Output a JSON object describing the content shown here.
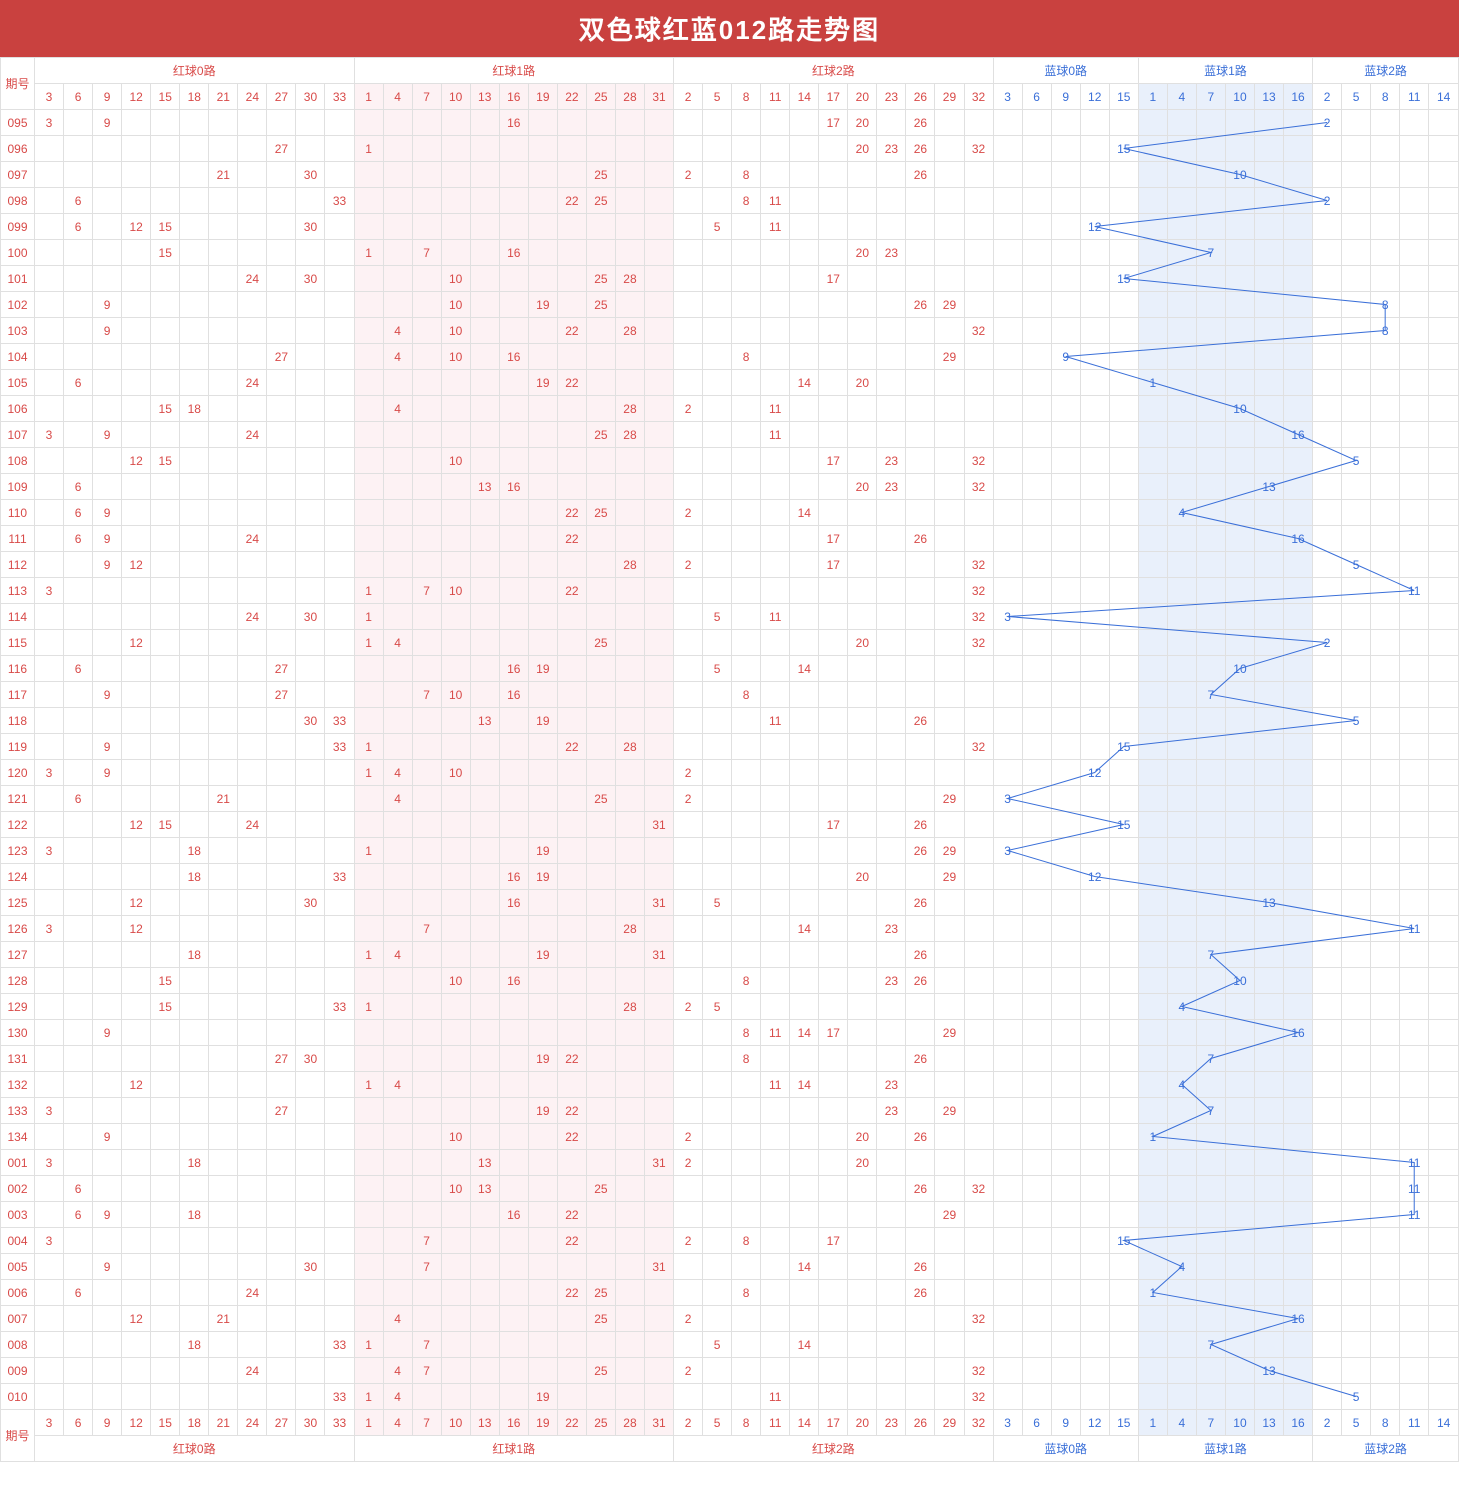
{
  "title": "双色球红蓝012路走势图",
  "period_header": "期号",
  "groups": [
    {
      "name": "红球0路",
      "nums": [
        3,
        6,
        9,
        12,
        15,
        18,
        21,
        24,
        27,
        30,
        33
      ],
      "type": "red",
      "shade": false
    },
    {
      "name": "红球1路",
      "nums": [
        1,
        4,
        7,
        10,
        13,
        16,
        19,
        22,
        25,
        28,
        31
      ],
      "type": "red",
      "shade": true
    },
    {
      "name": "红球2路",
      "nums": [
        2,
        5,
        8,
        11,
        14,
        17,
        20,
        23,
        26,
        29,
        32
      ],
      "type": "red",
      "shade": false
    },
    {
      "name": "蓝球0路",
      "nums": [
        3,
        6,
        9,
        12,
        15
      ],
      "type": "blue",
      "shade": false
    },
    {
      "name": "蓝球1路",
      "nums": [
        1,
        4,
        7,
        10,
        13,
        16
      ],
      "type": "blue",
      "shade": true
    },
    {
      "name": "蓝球2路",
      "nums": [
        2,
        5,
        8,
        11,
        14
      ],
      "type": "blue",
      "shade": false
    }
  ],
  "chart_data": {
    "type": "table",
    "title": "双色球红蓝012路走势图",
    "rows": [
      {
        "period": "095",
        "reds": [
          3,
          9,
          16,
          17,
          20,
          26
        ],
        "blue": 2
      },
      {
        "period": "096",
        "reds": [
          27,
          1,
          20,
          23,
          26,
          32
        ],
        "blue": 15
      },
      {
        "period": "097",
        "reds": [
          21,
          30,
          25,
          2,
          8,
          26
        ],
        "blue": 10
      },
      {
        "period": "098",
        "reds": [
          6,
          33,
          22,
          25,
          8,
          11
        ],
        "blue": 2
      },
      {
        "period": "099",
        "reds": [
          6,
          12,
          15,
          30,
          5,
          11
        ],
        "blue": 12
      },
      {
        "period": "100",
        "reds": [
          15,
          1,
          7,
          16,
          20,
          23
        ],
        "blue": 7
      },
      {
        "period": "101",
        "reds": [
          24,
          30,
          10,
          25,
          28,
          17
        ],
        "blue": 15
      },
      {
        "period": "102",
        "reds": [
          9,
          10,
          19,
          25,
          26,
          29
        ],
        "blue": 8
      },
      {
        "period": "103",
        "reds": [
          9,
          4,
          10,
          22,
          28,
          32
        ],
        "blue": 8
      },
      {
        "period": "104",
        "reds": [
          27,
          4,
          10,
          16,
          8,
          29
        ],
        "blue": 9
      },
      {
        "period": "105",
        "reds": [
          6,
          24,
          19,
          22,
          14,
          20
        ],
        "blue": 1
      },
      {
        "period": "106",
        "reds": [
          15,
          18,
          4,
          28,
          2,
          11
        ],
        "blue": 10
      },
      {
        "period": "107",
        "reds": [
          3,
          9,
          24,
          25,
          28,
          11
        ],
        "blue": 16
      },
      {
        "period": "108",
        "reds": [
          12,
          15,
          10,
          17,
          23,
          32
        ],
        "blue": 5
      },
      {
        "period": "109",
        "reds": [
          6,
          13,
          16,
          20,
          23,
          32
        ],
        "blue": 13
      },
      {
        "period": "110",
        "reds": [
          6,
          9,
          22,
          25,
          2,
          14
        ],
        "blue": 4
      },
      {
        "period": "111",
        "reds": [
          6,
          9,
          24,
          22,
          17,
          26
        ],
        "blue": 16
      },
      {
        "period": "112",
        "reds": [
          9,
          12,
          28,
          2,
          17,
          32
        ],
        "blue": 5
      },
      {
        "period": "113",
        "reds": [
          3,
          1,
          7,
          10,
          22,
          32
        ],
        "blue": 11
      },
      {
        "period": "114",
        "reds": [
          24,
          30,
          1,
          5,
          11,
          32
        ],
        "blue": 3
      },
      {
        "period": "115",
        "reds": [
          12,
          1,
          4,
          25,
          20,
          32
        ],
        "blue": 2
      },
      {
        "period": "116",
        "reds": [
          6,
          27,
          16,
          19,
          5,
          14
        ],
        "blue": 10
      },
      {
        "period": "117",
        "reds": [
          9,
          27,
          7,
          10,
          16,
          8
        ],
        "blue": 7
      },
      {
        "period": "118",
        "reds": [
          30,
          33,
          13,
          19,
          11,
          26
        ],
        "blue": 5
      },
      {
        "period": "119",
        "reds": [
          9,
          33,
          1,
          22,
          28,
          32
        ],
        "blue": 15
      },
      {
        "period": "120",
        "reds": [
          3,
          9,
          1,
          4,
          10,
          2
        ],
        "blue": 12
      },
      {
        "period": "121",
        "reds": [
          6,
          21,
          4,
          25,
          2,
          29
        ],
        "blue": 3
      },
      {
        "period": "122",
        "reds": [
          12,
          15,
          24,
          31,
          17,
          26
        ],
        "blue": 15
      },
      {
        "period": "123",
        "reds": [
          3,
          18,
          1,
          19,
          26,
          29
        ],
        "blue": 3
      },
      {
        "period": "124",
        "reds": [
          18,
          33,
          16,
          19,
          20,
          29
        ],
        "blue": 12
      },
      {
        "period": "125",
        "reds": [
          12,
          30,
          16,
          31,
          5,
          26
        ],
        "blue": 13
      },
      {
        "period": "126",
        "reds": [
          3,
          12,
          7,
          28,
          14,
          23
        ],
        "blue": 11
      },
      {
        "period": "127",
        "reds": [
          18,
          1,
          4,
          19,
          31,
          26
        ],
        "blue": 7
      },
      {
        "period": "128",
        "reds": [
          15,
          10,
          16,
          8,
          23,
          26
        ],
        "blue": 10
      },
      {
        "period": "129",
        "reds": [
          15,
          33,
          1,
          28,
          2,
          5
        ],
        "blue": 4
      },
      {
        "period": "130",
        "reds": [
          9,
          8,
          11,
          14,
          17,
          29
        ],
        "blue": 16
      },
      {
        "period": "131",
        "reds": [
          27,
          30,
          19,
          22,
          8,
          26
        ],
        "blue": 7
      },
      {
        "period": "132",
        "reds": [
          12,
          1,
          4,
          11,
          14,
          23
        ],
        "blue": 4
      },
      {
        "period": "133",
        "reds": [
          3,
          27,
          19,
          22,
          23,
          29
        ],
        "blue": 7
      },
      {
        "period": "134",
        "reds": [
          9,
          10,
          22,
          2,
          20,
          26
        ],
        "blue": 1
      },
      {
        "period": "001",
        "reds": [
          3,
          18,
          13,
          31,
          2,
          20
        ],
        "blue": 11
      },
      {
        "period": "002",
        "reds": [
          6,
          10,
          13,
          25,
          26,
          32
        ],
        "blue": 11
      },
      {
        "period": "003",
        "reds": [
          6,
          9,
          18,
          16,
          22,
          29
        ],
        "blue": 11
      },
      {
        "period": "004",
        "reds": [
          3,
          7,
          22,
          2,
          8,
          17
        ],
        "blue": 15
      },
      {
        "period": "005",
        "reds": [
          9,
          30,
          7,
          31,
          14,
          26
        ],
        "blue": 4
      },
      {
        "period": "006",
        "reds": [
          6,
          24,
          22,
          25,
          8,
          26
        ],
        "blue": 1
      },
      {
        "period": "007",
        "reds": [
          12,
          21,
          4,
          25,
          2,
          32
        ],
        "blue": 16
      },
      {
        "period": "008",
        "reds": [
          18,
          33,
          1,
          7,
          5,
          14
        ],
        "blue": 7
      },
      {
        "period": "009",
        "reds": [
          24,
          4,
          7,
          25,
          2,
          32
        ],
        "blue": 13
      },
      {
        "period": "010",
        "reds": [
          33,
          1,
          4,
          19,
          11,
          32
        ],
        "blue": 5
      }
    ]
  }
}
